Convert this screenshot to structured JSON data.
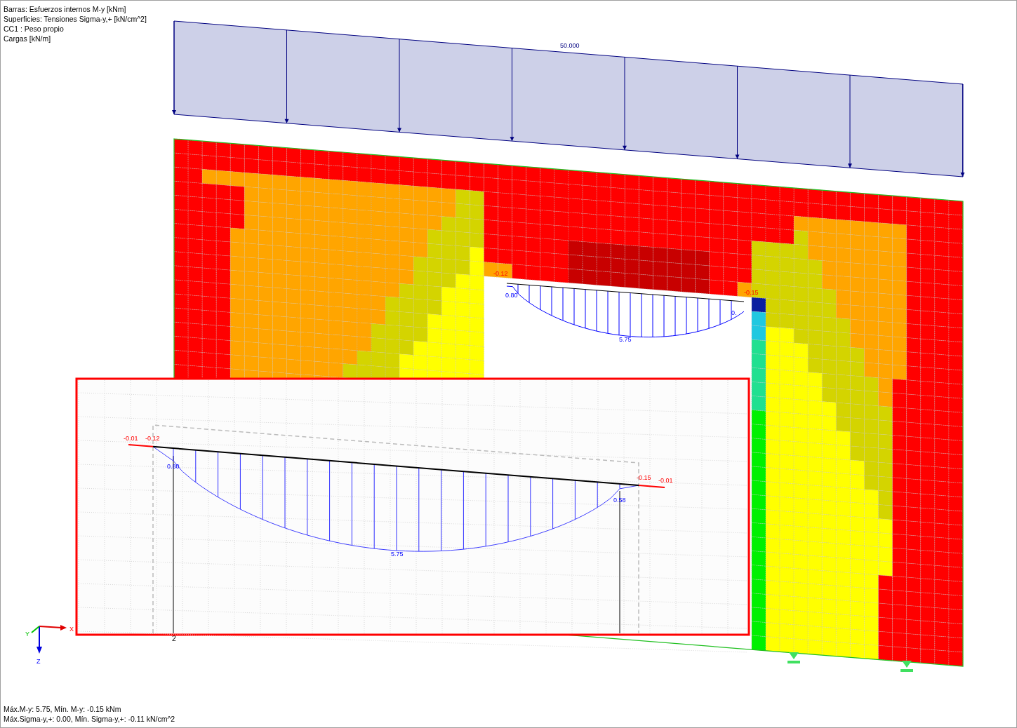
{
  "legend": [
    "Barras: Esfuerzos internos M-y [kNm]",
    "Superficies: Tensiones Sigma-y,+ [kN/cm^2]",
    "CC1 : Peso propio",
    "Cargas [kN/m]"
  ],
  "load": {
    "value": "50.000"
  },
  "moment_labels": [
    {
      "kind": "end",
      "text": "-0.12"
    },
    {
      "kind": "value",
      "text": "0.80"
    },
    {
      "kind": "end",
      "text": "-0.15"
    },
    {
      "kind": "value",
      "text": "0."
    },
    {
      "kind": "value",
      "text": "5.75"
    }
  ],
  "node_label": "2",
  "inset": {
    "labels": [
      {
        "kind": "end",
        "text": "-0.01"
      },
      {
        "kind": "end",
        "text": "-0.12"
      },
      {
        "kind": "value",
        "text": "0.80"
      },
      {
        "kind": "end",
        "text": "-0.15"
      },
      {
        "kind": "end",
        "text": "-0.01"
      },
      {
        "kind": "value",
        "text": "0.58"
      },
      {
        "kind": "value",
        "text": "5.75"
      }
    ]
  },
  "axes": {
    "x": "X",
    "y": "Y",
    "z": "Z"
  },
  "status": [
    "Máx.M-y: 5.75, Mín. M-y: -0.15 kNm",
    "Máx.Sigma-y,+: 0.00, Mín. Sigma-y,+: -0.11 kN/cm^2"
  ]
}
